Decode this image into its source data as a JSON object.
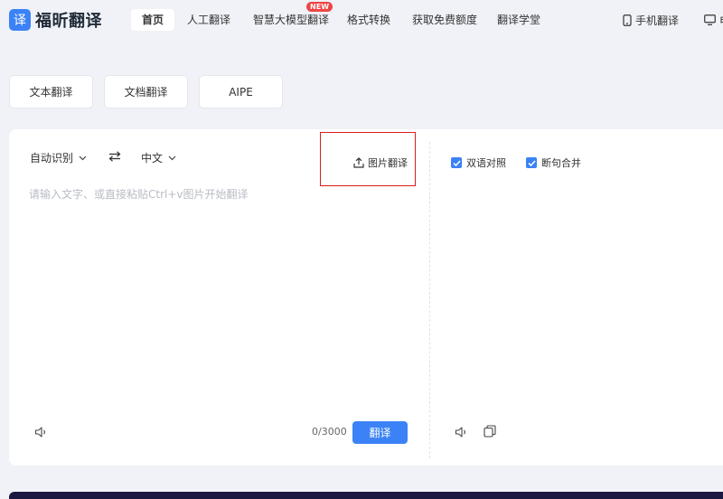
{
  "brand": {
    "badge": "译",
    "name": "福昕翻译"
  },
  "nav": {
    "items": [
      {
        "label": "首页",
        "active": true
      },
      {
        "label": "人工翻译"
      },
      {
        "label": "智慧大模型翻译",
        "badge": "NEW"
      },
      {
        "label": "格式转换"
      },
      {
        "label": "获取免费额度"
      },
      {
        "label": "翻译学堂"
      }
    ],
    "mobile": "手机翻译",
    "desktop": "电"
  },
  "modes": [
    "文本翻译",
    "文档翻译",
    "AIPE"
  ],
  "source": {
    "lang": "自动识别",
    "target_lang": "中文",
    "image_translate": "图片翻译",
    "placeholder": "请输入文字、或直接粘贴Ctrl+v图片开始翻译",
    "counter": "0/3000",
    "translate_button": "翻译"
  },
  "output": {
    "options": [
      {
        "label": "双语对照",
        "checked": true
      },
      {
        "label": "断句合并",
        "checked": true
      }
    ]
  },
  "colors": {
    "accent": "#3b82f6",
    "highlight_box": "#d81e1e",
    "background": "#f0f2f7"
  }
}
